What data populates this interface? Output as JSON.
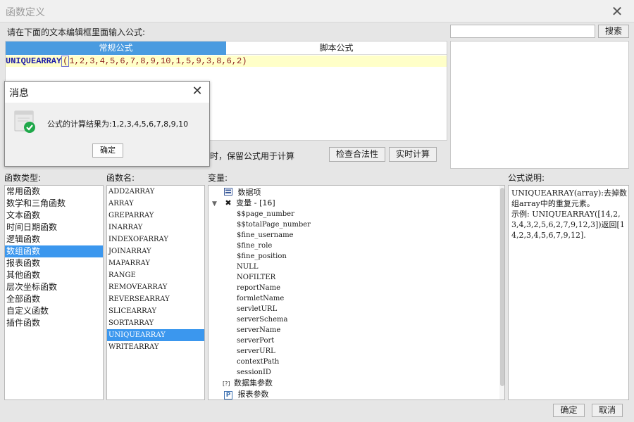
{
  "window": {
    "title": "函数定义",
    "close": "✕"
  },
  "editor": {
    "instruction": "请在下面的文本编辑框里面输入公式:",
    "tabs": [
      "常规公式",
      "脚本公式"
    ],
    "formula_name": "UNIQUEARRAY",
    "formula_paren": "(",
    "formula_args": "1,2,3,4,5,6,7,8,9,10,1,5,9,3,8,6,2)"
  },
  "search": {
    "value": "",
    "button": "搜索"
  },
  "options": {
    "keep_text": "时，保留公式用于计算",
    "check_button": "检查合法性",
    "calc_button": "实时计算"
  },
  "labels": {
    "categories": "函数类型:",
    "functions": "函数名:",
    "variables": "变量:",
    "description": "公式说明:"
  },
  "categories": [
    "常用函数",
    "数学和三角函数",
    "文本函数",
    "时间日期函数",
    "逻辑函数",
    "数组函数",
    "报表函数",
    "其他函数",
    "层次坐标函数",
    "全部函数",
    "自定义函数",
    "插件函数"
  ],
  "selected_category": 5,
  "functions": [
    "ADD2ARRAY",
    "ARRAY",
    "GREPARRAY",
    "INARRAY",
    "INDEXOFARRAY",
    "JOINARRAY",
    "MAPARRAY",
    "RANGE",
    "REMOVEARRAY",
    "REVERSEARRAY",
    "SLICEARRAY",
    "SORTARRAY",
    "UNIQUEARRAY",
    "WRITEARRAY"
  ],
  "selected_function": 12,
  "variables": {
    "data_items": "数据项",
    "var_group": "变量 - [16]",
    "vars": [
      "$$page_number",
      "$$totalPage_number",
      "$fine_username",
      "$fine_role",
      "$fine_position",
      "NULL",
      "NOFILTER",
      "reportName",
      "formletName",
      "servletURL",
      "serverSchema",
      "serverName",
      "serverPort",
      "serverURL",
      "contextPath",
      "sessionID"
    ],
    "dataset_params": "数据集参数",
    "report_params": "报表参数",
    "p_icon": "P",
    "r_icon": "[?]"
  },
  "description": {
    "name": "UNIQUEARRAY",
    "text": "UNIQUEARRAY(array):去掉数组array中的重复元素。\n示例: UNIQUEARRAY([14,2,3,4,3,2,5,6,2,7,9,12,3])返回[14,2,3,4,5,6,7,9,12]."
  },
  "footer": {
    "ok": "确定",
    "cancel": "取消"
  },
  "message_box": {
    "title": "消息",
    "close": "✕",
    "text": "公式的计算结果为:1,2,3,4,5,6,7,8,9,10",
    "ok": "确定"
  },
  "colors": {
    "selection": "#3b97ee",
    "tab_active": "#4a9be0",
    "formula_bg": "#ffffc8",
    "success_icon": "#1fa84a"
  }
}
